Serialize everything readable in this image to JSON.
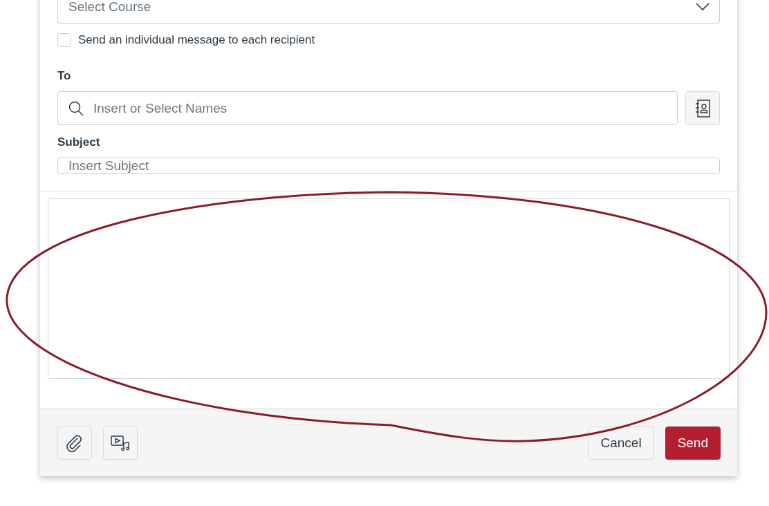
{
  "course_select": {
    "placeholder": "Select Course"
  },
  "individual_message": {
    "label": "Send an individual message to each recipient",
    "checked": false
  },
  "to": {
    "label": "To",
    "placeholder": "Insert or Select Names"
  },
  "subject": {
    "label": "Subject",
    "placeholder": "Insert Subject"
  },
  "footer": {
    "buttons": [
      {
        "label": "Cancel",
        "kind": "secondary"
      },
      {
        "label": "Send",
        "kind": "primary"
      }
    ]
  }
}
